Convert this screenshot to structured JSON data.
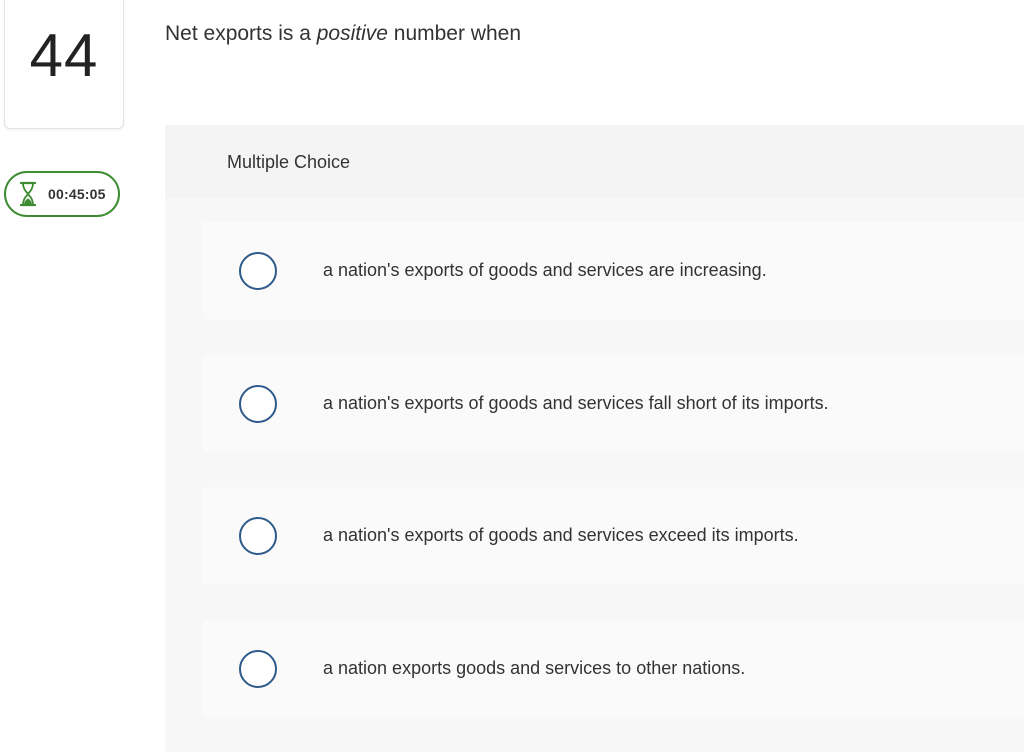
{
  "question": {
    "number": "44",
    "prompt_before": "Net exports is a ",
    "prompt_emphasis": "positive",
    "prompt_after": " number when"
  },
  "timer": {
    "icon": "hourglass-icon",
    "time": "00:45:05",
    "border_color": "#3d8b32"
  },
  "answer_panel": {
    "type_label": "Multiple Choice",
    "choices": [
      {
        "label": "a nation's exports of goods and services are increasing.",
        "selected": false
      },
      {
        "label": "a nation's exports of goods and services fall short of its imports.",
        "selected": false
      },
      {
        "label": "a nation's exports of goods and services exceed its imports.",
        "selected": false
      },
      {
        "label": "a nation exports goods and services to other nations.",
        "selected": false
      }
    ]
  },
  "colors": {
    "radio_border": "#2e5b8a",
    "panel_bg": "#f4f4f4"
  }
}
